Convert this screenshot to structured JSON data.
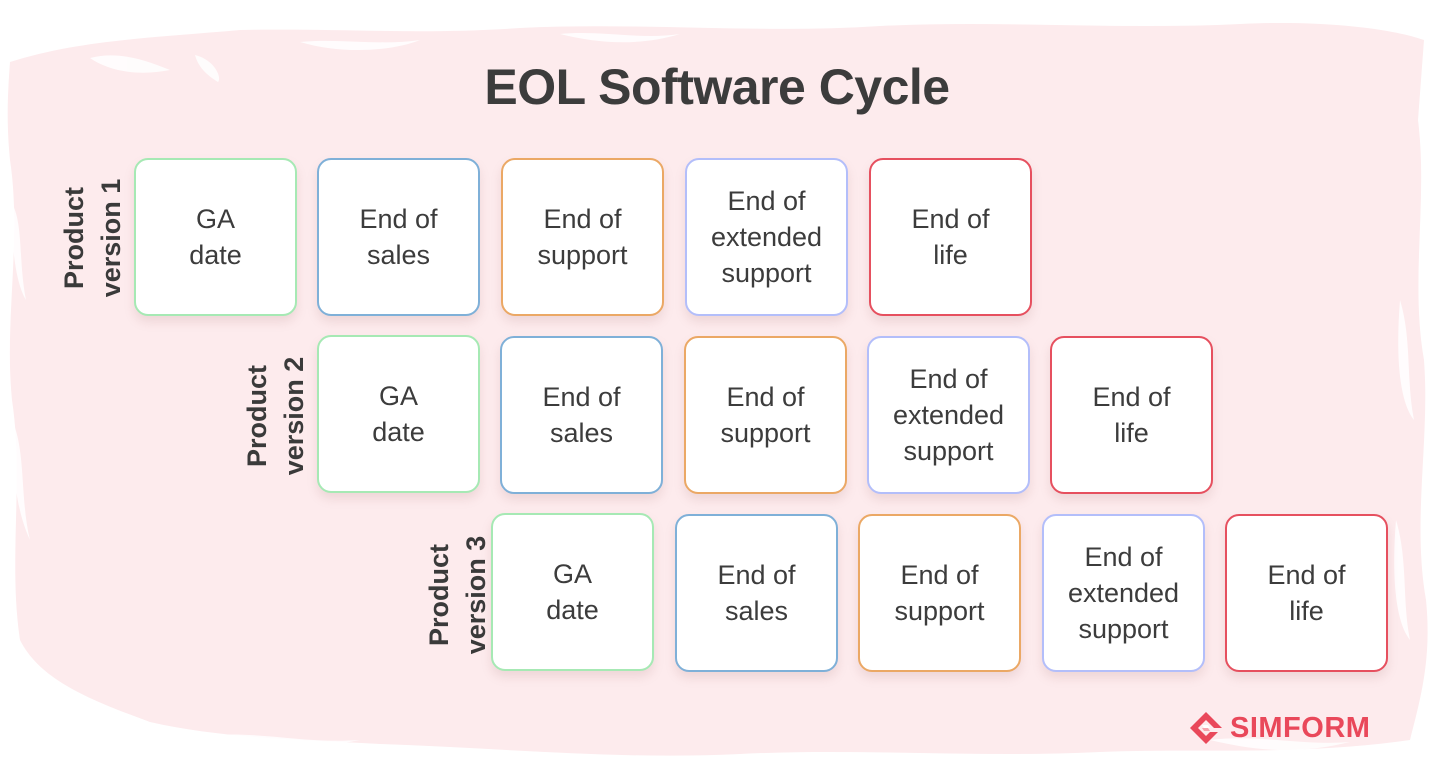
{
  "title": "EOL Software Cycle",
  "colors": {
    "background_paint": "#fdebed",
    "ga_date": "#a6e9b4",
    "end_of_sales": "#7fb0d8",
    "end_of_support": "#eba865",
    "end_of_extended_support": "#b3befa",
    "end_of_life": "#e6505f",
    "text": "#3c3c3c",
    "brand": "#e9485a"
  },
  "rows": [
    {
      "label": "Product\nversion 1",
      "stages": [
        {
          "key": "ga_date",
          "label": "GA\ndate"
        },
        {
          "key": "end_of_sales",
          "label": "End of\nsales"
        },
        {
          "key": "end_of_support",
          "label": "End of\nsupport"
        },
        {
          "key": "end_of_extended_support",
          "label": "End of\nextended\nsupport"
        },
        {
          "key": "end_of_life",
          "label": "End of\nlife"
        }
      ]
    },
    {
      "label": "Product\nversion 2",
      "stages": [
        {
          "key": "ga_date",
          "label": "GA\ndate"
        },
        {
          "key": "end_of_sales",
          "label": "End of\nsales"
        },
        {
          "key": "end_of_support",
          "label": "End of\nsupport"
        },
        {
          "key": "end_of_extended_support",
          "label": "End of\nextended\nsupport"
        },
        {
          "key": "end_of_life",
          "label": "End of\nlife"
        }
      ]
    },
    {
      "label": "Product\nversion 3",
      "stages": [
        {
          "key": "ga_date",
          "label": "GA\ndate"
        },
        {
          "key": "end_of_sales",
          "label": "End of\nsales"
        },
        {
          "key": "end_of_support",
          "label": "End of\nsupport"
        },
        {
          "key": "end_of_extended_support",
          "label": "End of\nextended\nsupport"
        },
        {
          "key": "end_of_life",
          "label": "End of\nlife"
        }
      ]
    }
  ],
  "brand": {
    "name": "SIMFORM",
    "icon": "simform-logo-icon"
  }
}
